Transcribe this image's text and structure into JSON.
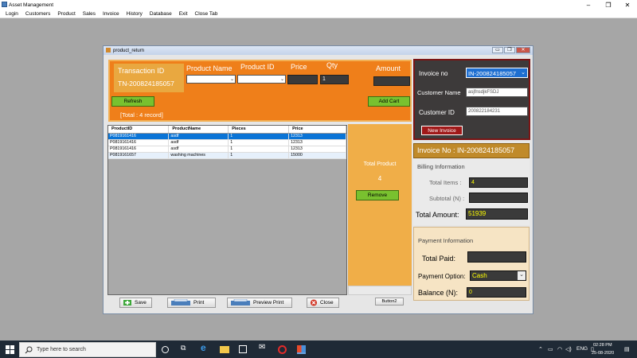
{
  "app": {
    "title": "Asset Management",
    "menu": [
      "Login",
      "Customers",
      "Product",
      "Sales",
      "Invoice",
      "History",
      "Database",
      "Exit",
      "Close Tab"
    ]
  },
  "window": {
    "title": "product_return"
  },
  "transaction": {
    "label": "Transaction ID",
    "value": "TN-200824185057"
  },
  "form": {
    "product_name_label": "Product Name",
    "product_id_label": "Product ID",
    "price_label": "Price",
    "qty_label": "Qty",
    "qty_value": "1",
    "amount_label": "Amount",
    "refresh_label": "Refresh",
    "add_cart_label": "Add Cart",
    "total_records": "[Total : 4 record]"
  },
  "grid": {
    "headers": [
      "ProductID",
      "ProductName",
      "Pieces",
      "Price"
    ],
    "rows": [
      [
        "P0819161416",
        "asdf",
        "1",
        "12313"
      ],
      [
        "P0819161416",
        "asdf",
        "1",
        "12313"
      ],
      [
        "P0819161416",
        "asdf",
        "1",
        "12313"
      ],
      [
        "P0819161657",
        "washing machines",
        "1",
        "15000"
      ]
    ]
  },
  "middle": {
    "total_product_label": "Total Product",
    "total_product_value": "4",
    "remove_label": "Remove",
    "button2_label": "Button2"
  },
  "actions": {
    "save_label": "Save",
    "print_label": "Print",
    "preview_print_label": "Preview Print",
    "close_label": "Close"
  },
  "invoice": {
    "invoice_no_label": "Invoice no",
    "invoice_no_value": "IN-200824185057",
    "customer_name_label": "Customer  Name",
    "customer_name_value": "asjfnsdjkFSDJ",
    "customer_id_label": "Customer  ID",
    "customer_id_value": "200822184231",
    "new_invoice_label": "New Invoice",
    "header": "Invoice No :  IN-200824185057"
  },
  "billing": {
    "section_label": "Billing Information",
    "total_items_label": "Total Items :",
    "total_items_value": "4",
    "subtotal_label": "Subtotal (N) :",
    "subtotal_value": "",
    "total_amount_label": "Total Amount:",
    "total_amount_value": "51939"
  },
  "payment": {
    "section_label": "Payment Information",
    "total_paid_label": "Total Paid:",
    "total_paid_value": "",
    "option_label": "Payment Option:",
    "option_value": "Cash",
    "balance_label": "Balance (N):",
    "balance_value": "0"
  },
  "taskbar": {
    "search_placeholder": "Type here to search",
    "language": "ENG",
    "time": "02:28 PM",
    "date": "25-08-2020"
  },
  "colors": {
    "accent_orange": "#ef7f1a",
    "selection_blue": "#0a74d6",
    "button_green": "#79c12f",
    "invoice_panel": "#3d3a3a",
    "new_invoice_red": "#a01818"
  }
}
